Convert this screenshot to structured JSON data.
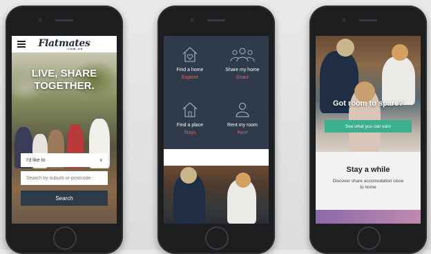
{
  "phone1": {
    "logo": "Flatmates",
    "logo_sub": ".com.au",
    "hero_title_line1": "LIVE, SHARE",
    "hero_title_line2": "TOGETHER.",
    "select_value": "I'd like to",
    "select_chevron": "v",
    "search_placeholder": "Search by suburb or postcode",
    "search_button": "Search"
  },
  "phone2": {
    "menu": [
      {
        "title": "Find a home",
        "sub": "Explore",
        "icon": "house-heart-icon"
      },
      {
        "title": "Share my home",
        "sub": "Share",
        "icon": "people-group-icon"
      },
      {
        "title": "Find a place",
        "sub": "Stays",
        "icon": "house-icon"
      },
      {
        "title": "Rent my room",
        "sub": "Rent",
        "icon": "person-icon"
      }
    ]
  },
  "phone3": {
    "title": "Got room to spare?",
    "button": "See what you can earn",
    "panel_title": "Stay a while",
    "panel_desc": "Discover share accomodation close to home"
  },
  "colors": {
    "navy": "#2f3b4a",
    "accent_red": "#e8604c",
    "teal": "#3bb08f"
  }
}
